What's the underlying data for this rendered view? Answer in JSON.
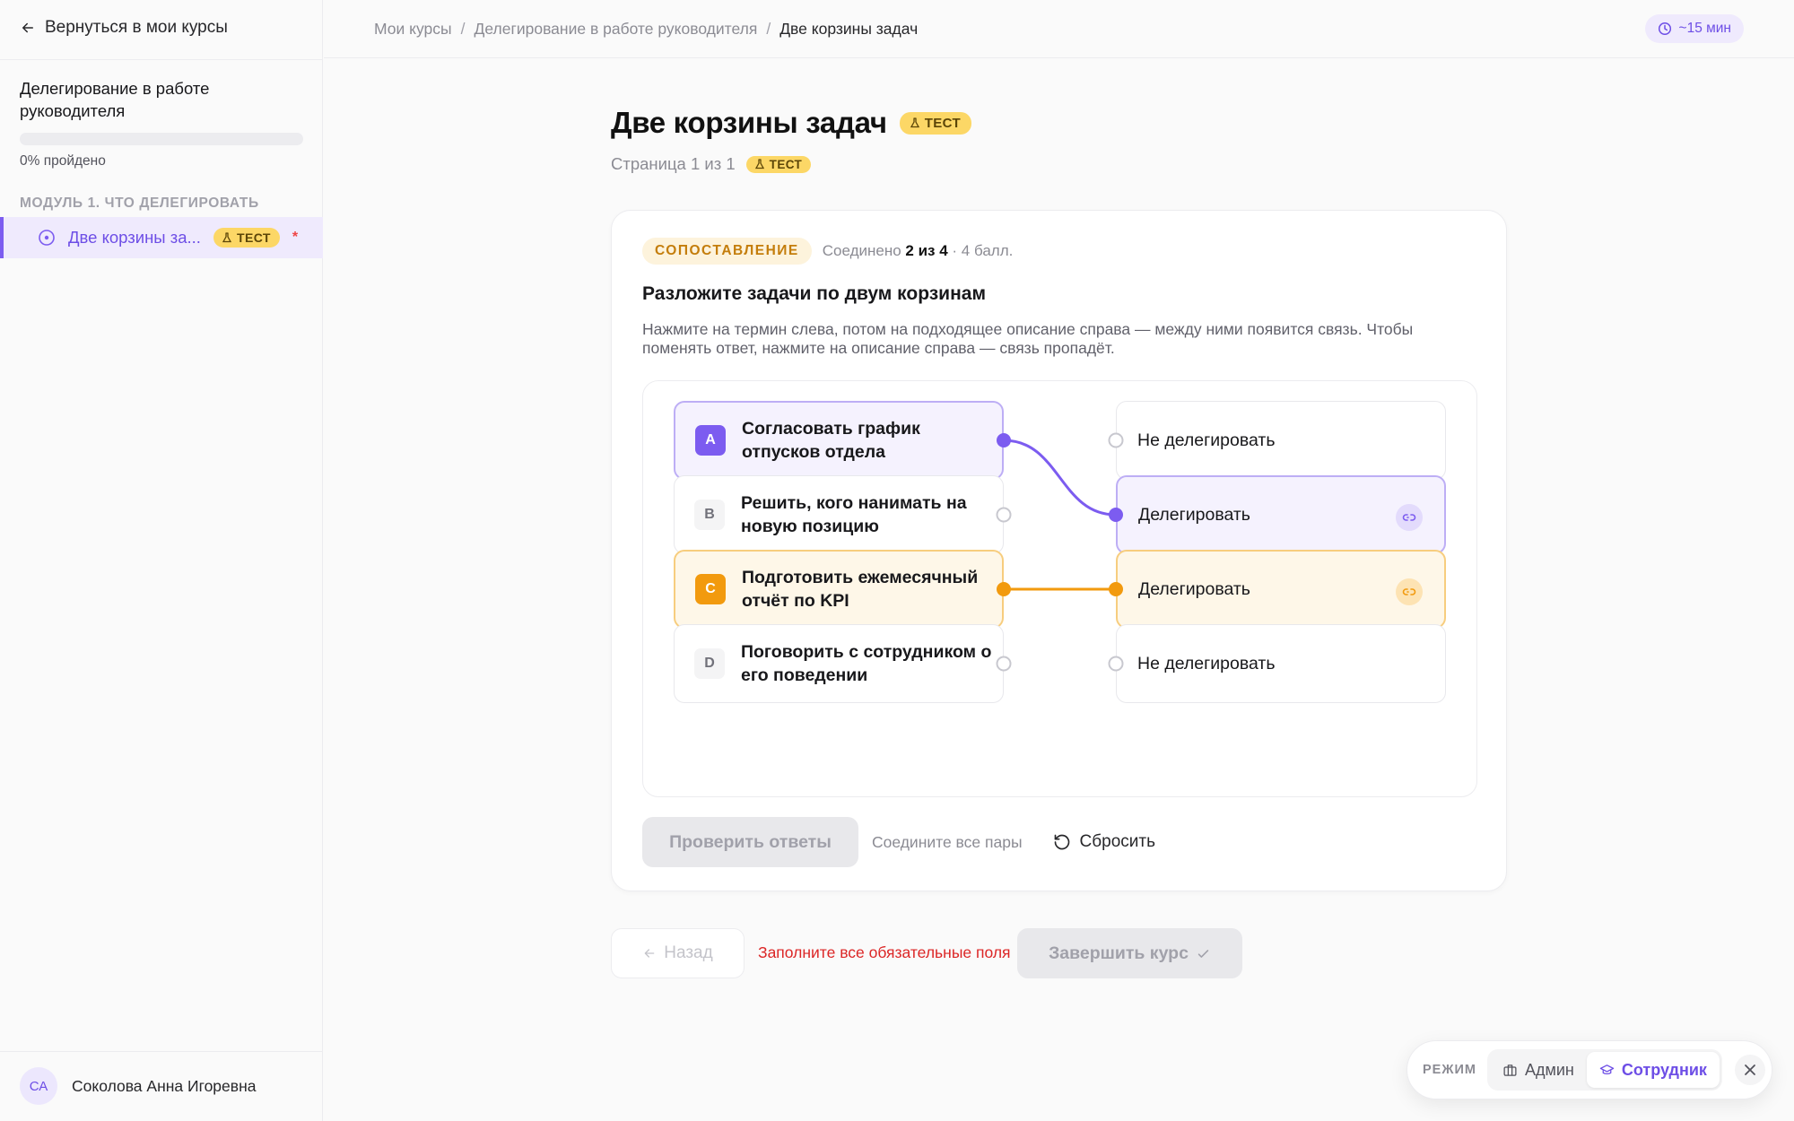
{
  "sidebar": {
    "back_label": "Вернуться в мои курсы",
    "course_title": "Делегирование в работе руководителя",
    "progress_percent": 0,
    "progress_text": "0% пройдено",
    "module_title": "Модуль 1. Что делегировать",
    "lesson": {
      "label": "Две корзины за...",
      "badge": "ТЕСТ",
      "required_mark": "*"
    },
    "user": {
      "initials": "СА",
      "name": "Соколова Анна Игоревна"
    }
  },
  "topbar": {
    "breadcrumb": [
      "Мои курсы",
      "Делегирование в работе руководителя",
      "Две корзины задач"
    ],
    "separator": "/",
    "time_estimate": "~15 мин"
  },
  "page": {
    "title": "Две корзины задач",
    "title_badge": "ТЕСТ",
    "page_indicator": "Страница 1 из 1",
    "page_badge": "ТЕСТ"
  },
  "question": {
    "type_label": "СОПОСТАВЛЕНИЕ",
    "connected_prefix": "Соединено",
    "connected_count": "2 из 4",
    "points": "· 4 балл.",
    "title": "Разложите задачи по двум корзинам",
    "description": "Нажмите на термин слева, потом на подходящее описание справа — между ними появится связь. Чтобы поменять ответ, нажмите на описание справа — связь пропадёт.",
    "terms": [
      {
        "letter": "A",
        "text": "Согласовать график отпусков отдела",
        "state": "linked-purple"
      },
      {
        "letter": "B",
        "text": "Решить, кого нанимать на новую позицию",
        "state": ""
      },
      {
        "letter": "C",
        "text": "Подготовить ежемесячный отчёт по KPI",
        "state": "linked-orange"
      },
      {
        "letter": "D",
        "text": "Поговорить с сотрудником о его поведении",
        "state": ""
      }
    ],
    "definitions": [
      {
        "text": "Не делегировать",
        "state": ""
      },
      {
        "text": "Делегировать",
        "state": "linked-purple"
      },
      {
        "text": "Делегировать",
        "state": "linked-orange"
      },
      {
        "text": "Не делегировать",
        "state": ""
      }
    ],
    "connections": [
      {
        "from": 0,
        "to": 1,
        "color": "#7c5cf0"
      },
      {
        "from": 2,
        "to": 2,
        "color": "#f29a0e"
      }
    ],
    "check_label": "Проверить ответы",
    "hint": "Соедините все пары",
    "reset_label": "Сбросить"
  },
  "footer": {
    "back_label": "Назад",
    "required_msg": "Заполните все обязательные поля",
    "finish_label": "Завершить курс"
  },
  "mode": {
    "label": "РЕЖИМ",
    "admin_label": "Админ",
    "employee_label": "Сотрудник",
    "active": "employee"
  },
  "colors": {
    "accent": "#7c5cf0",
    "orange": "#f29a0e",
    "badge_yellow": "#fcd766",
    "error": "#dc2626"
  }
}
